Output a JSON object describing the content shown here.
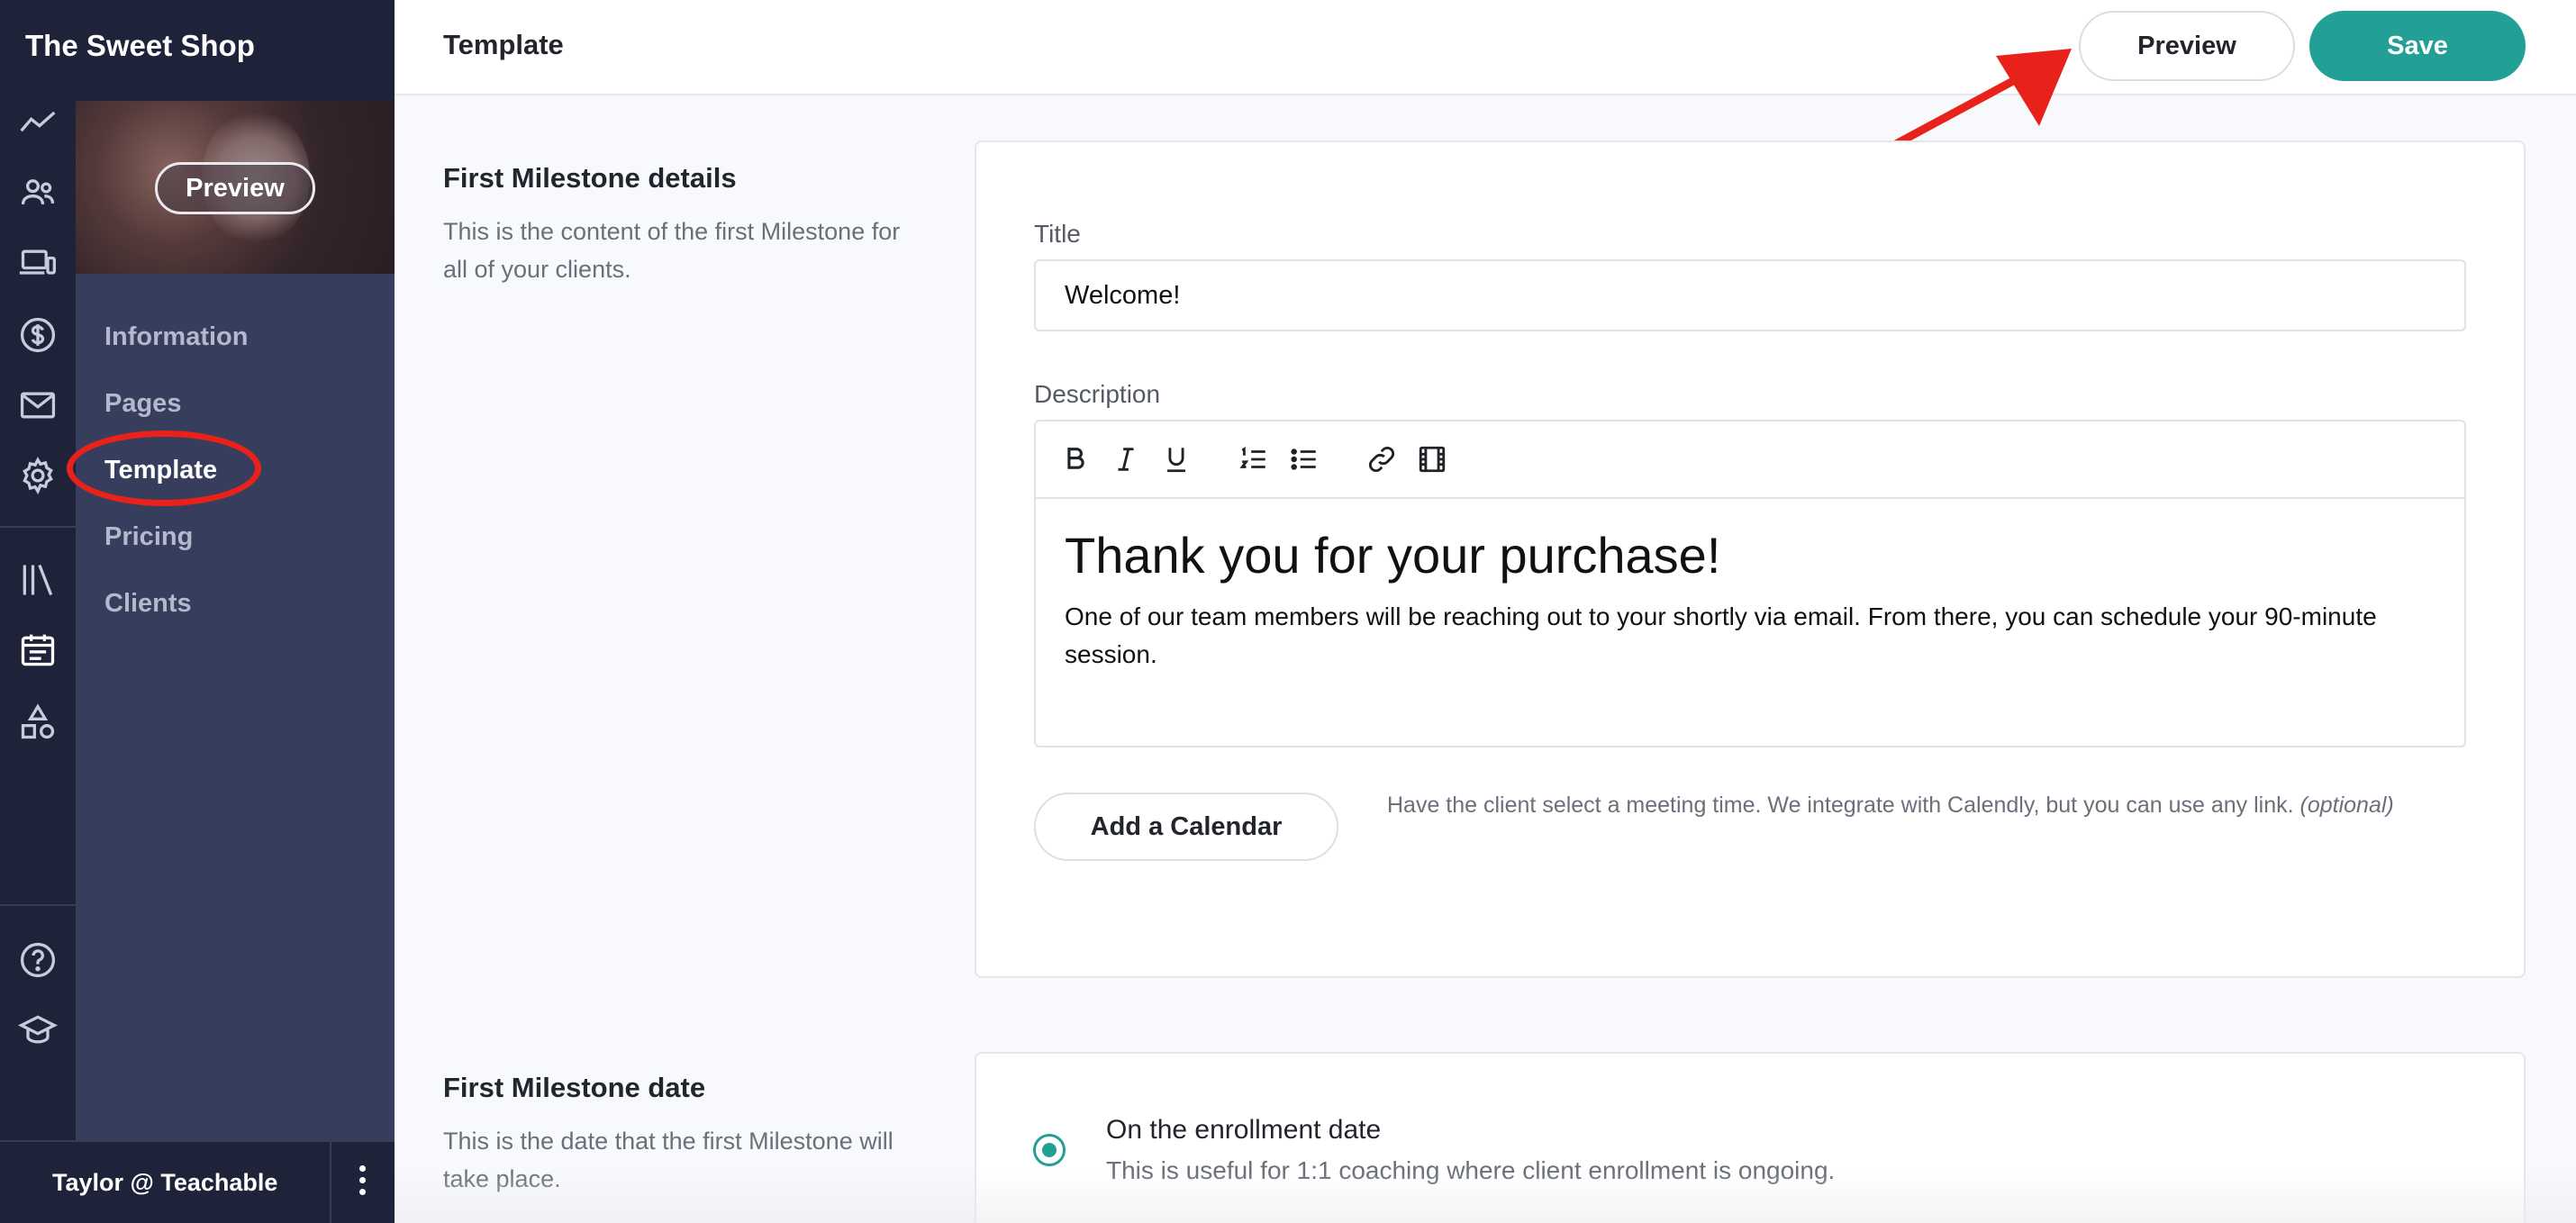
{
  "sidebar": {
    "school_name": "The Sweet Shop",
    "cover_preview_label": "Preview",
    "rail_icons": [
      "chart-line-icon",
      "users-icon",
      "devices-icon",
      "dollar-icon",
      "mail-icon",
      "gear-icon",
      "library-icon",
      "calendar-icon",
      "shapes-icon",
      "help-icon",
      "graduation-cap-icon"
    ],
    "nav_items": [
      {
        "label": "Information"
      },
      {
        "label": "Pages"
      },
      {
        "label": "Template",
        "active": true
      },
      {
        "label": "Pricing"
      },
      {
        "label": "Clients"
      }
    ],
    "user_name": "Taylor @ Teachable"
  },
  "header": {
    "title": "Template",
    "preview_label": "Preview",
    "save_label": "Save"
  },
  "milestone_details": {
    "title": "First Milestone details",
    "description": "This is the content of the first Milestone for all of your clients.",
    "title_label": "Title",
    "title_value": "Welcome!",
    "description_label": "Description",
    "editor_heading": "Thank you for your purchase!",
    "editor_body": "One of our team members will be reaching out to your shortly via email. From there, you can schedule your 90-minute session.",
    "add_calendar_label": "Add a Calendar",
    "calendar_help": "Have the client select a meeting time. We integrate with Calendly, but you can use any link.",
    "calendar_optional": "(optional)"
  },
  "milestone_date": {
    "title": "First Milestone date",
    "description": "This is the date that the first Milestone will take place.",
    "option_label": "On the enrollment date",
    "option_help": "This is useful for 1:1 coaching where client enrollment is ongoing."
  },
  "colors": {
    "brand_teal": "#23a095",
    "sidebar_dark": "#1f2339",
    "subnav": "#373d5c",
    "annotation_red": "#e8221a"
  }
}
